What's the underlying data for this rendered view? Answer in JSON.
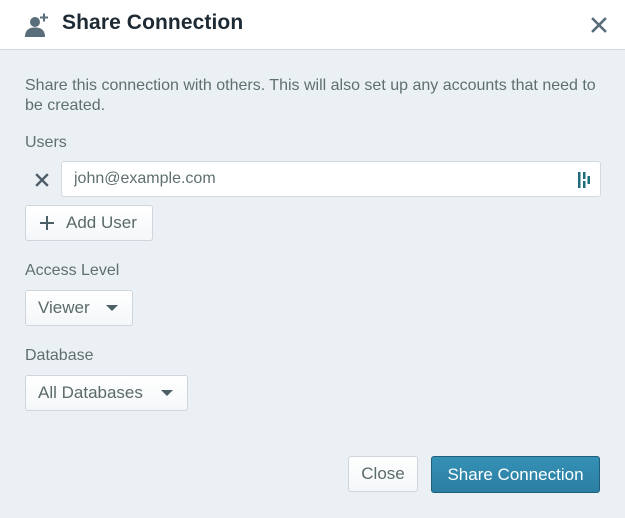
{
  "dialog": {
    "title": "Share Connection",
    "header_icon": "add-user-icon",
    "close_icon": "close-icon"
  },
  "description": "Share this connection with others. This will also set up any accounts that need to be created.",
  "users": {
    "label": "Users",
    "entries": [
      {
        "email": "john@example.com",
        "remove_icon": "close-icon",
        "field_icon": "password-manager-icon"
      }
    ],
    "add_label": "Add User",
    "add_icon": "plus-icon"
  },
  "access_level": {
    "label": "Access Level",
    "selected": "Viewer"
  },
  "database": {
    "label": "Database",
    "selected": "All Databases"
  },
  "footer": {
    "close_label": "Close",
    "share_label": "Share Connection"
  },
  "colors": {
    "primary": "#2e86ab",
    "background": "#ebf0f4",
    "header_bg": "#ffffff",
    "title_text": "#1e2a33",
    "body_text": "#5f6f6f"
  }
}
